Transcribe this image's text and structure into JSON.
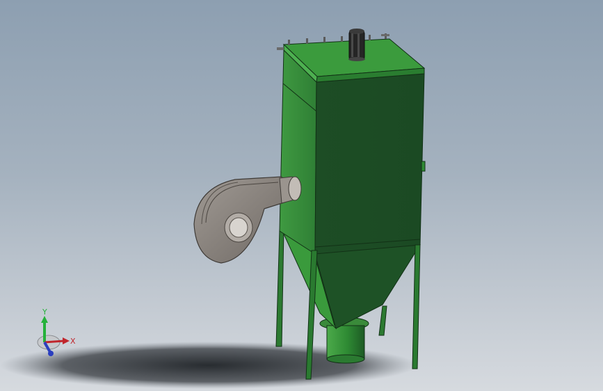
{
  "viewport": {
    "background_top": "#8d9fb1",
    "background_bottom": "#d6dadf"
  },
  "model": {
    "body_color": "#2f8a34",
    "body_dark": "#1d5425",
    "fan_color": "#8c8580",
    "motor_color": "#2a2a2a"
  },
  "triad": {
    "x_label": "X",
    "y_label": "Y",
    "x_color": "#c0262c",
    "y_color": "#25b13a",
    "z_color": "#2b3fbf"
  }
}
